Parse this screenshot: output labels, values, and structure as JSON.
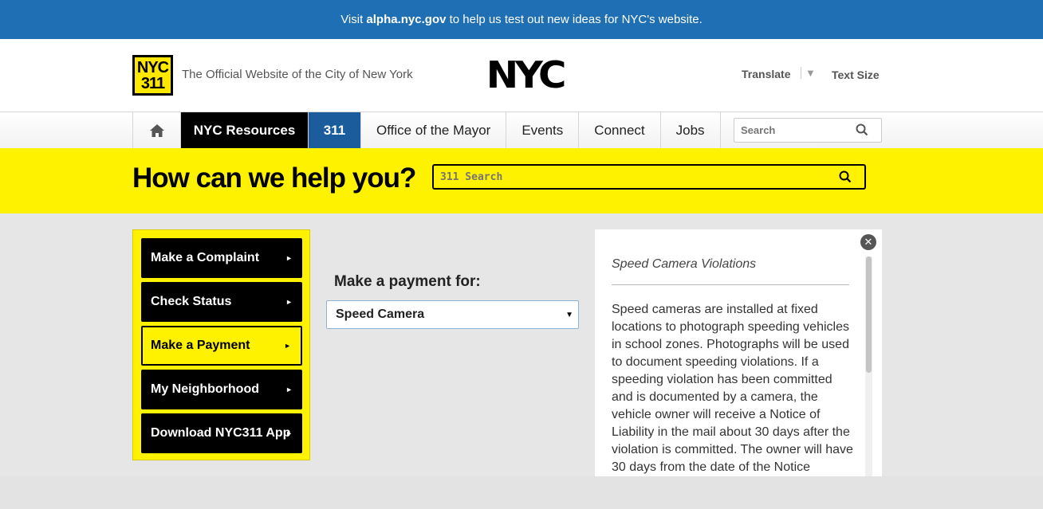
{
  "banner": {
    "prefix": "Visit ",
    "link": "alpha.nyc.gov",
    "suffix": " to help us test out new ideas for NYC's website."
  },
  "header": {
    "logo_line1": "NYC",
    "logo_line2": "311",
    "tagline": "The Official Website of the City of New York",
    "brand": "NYC",
    "translate_label": "Translate",
    "translate_caret": "▼",
    "textsize_label": "Text Size"
  },
  "nav": {
    "items": [
      {
        "label": "NYC Resources"
      },
      {
        "label": "311"
      },
      {
        "label": "Office of the Mayor"
      },
      {
        "label": "Events"
      },
      {
        "label": "Connect"
      },
      {
        "label": "Jobs"
      }
    ],
    "search_placeholder": "Search"
  },
  "hero": {
    "heading": "How can we help you?",
    "search_placeholder": "311 Search"
  },
  "sidebar": {
    "items": [
      {
        "label": "Make a Complaint"
      },
      {
        "label": "Check Status"
      },
      {
        "label": "Make a Payment"
      },
      {
        "label": "My Neighborhood"
      },
      {
        "label": "Download NYC311 App"
      }
    ],
    "arrow": "►"
  },
  "payment": {
    "label": "Make a payment for:",
    "selected": "Speed Camera"
  },
  "info": {
    "title": "Speed Camera Violations",
    "close": "✕",
    "body": "Speed cameras are installed at fixed locations to photograph speeding vehicles in school zones. Photographs will be used to document speeding violations. If a speeding violation has been committed and is documented by a camera, the vehicle owner will receive a Notice of Liability in the mail about 30 days after the violation is committed. The owner will have 30 days from the date of the Notice"
  },
  "colors": {
    "banner_blue": "#1f6fb5",
    "brand_yellow": "#fff200",
    "nav_311_blue": "#1b5d9c"
  }
}
